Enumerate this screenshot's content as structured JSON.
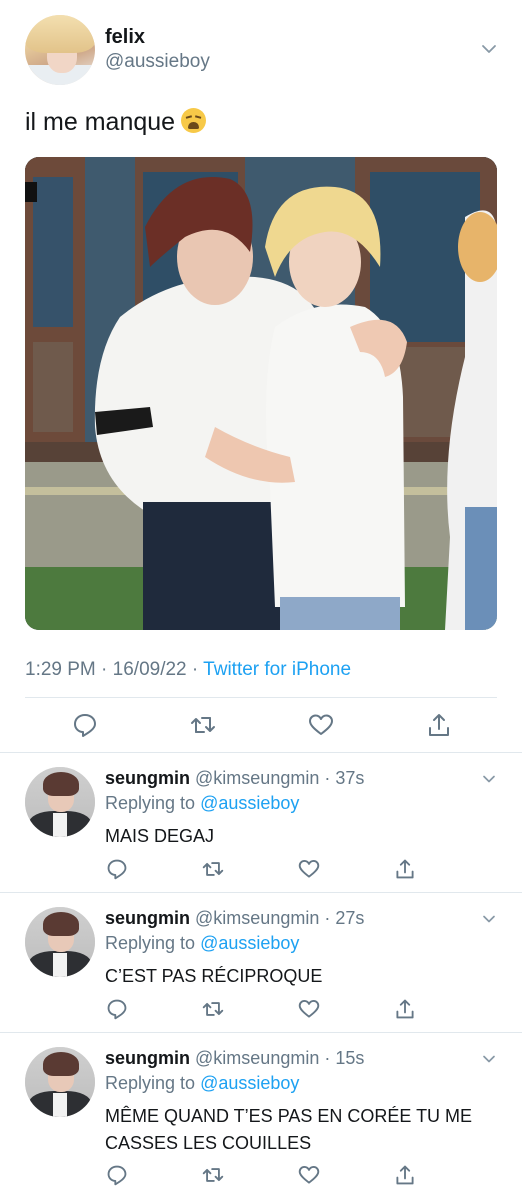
{
  "tweet": {
    "author_name": "felix",
    "author_handle": "@aussieboy",
    "text": "il me manque",
    "emoji": "weary-face-emoji",
    "time": "1:29 PM",
    "separator": " · ",
    "date": "16/09/22",
    "source": "Twitter for iPhone"
  },
  "actions": [
    "reply-icon",
    "retweet-icon",
    "like-icon",
    "share-icon"
  ],
  "replies": [
    {
      "name": "seungmin",
      "handle": "@kimseungmin",
      "dot": " · ",
      "time": "37s",
      "replying_prefix": "Replying to ",
      "replying_to": "@aussieboy",
      "text": "MAIS DEGAJ"
    },
    {
      "name": "seungmin",
      "handle": "@kimseungmin",
      "dot": " · ",
      "time": "27s",
      "replying_prefix": "Replying to ",
      "replying_to": "@aussieboy",
      "text": "C’EST PAS RÉCIPROQUE"
    },
    {
      "name": "seungmin",
      "handle": "@kimseungmin",
      "dot": " · ",
      "time": "15s",
      "replying_prefix": "Replying to ",
      "replying_to": "@aussieboy",
      "text": "MÊME QUAND T’ES PAS EN CORÉE TU ME CASSES LES COUILLES"
    }
  ],
  "colors": {
    "accent": "#1da1f2",
    "secondary_text": "#657786",
    "divider": "#e1e8ed",
    "icon": "#657786"
  }
}
